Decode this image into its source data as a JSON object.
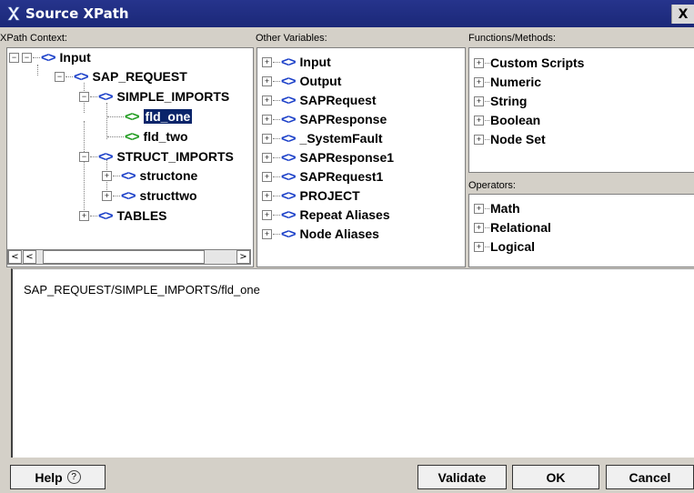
{
  "window": {
    "title": "Source XPath",
    "close_label": "X"
  },
  "context": {
    "label": "XPath Context:",
    "items": [
      {
        "label": "Input"
      },
      {
        "label": "SAP_REQUEST"
      },
      {
        "label": "SIMPLE_IMPORTS"
      },
      {
        "label": "fld_one"
      },
      {
        "label": "fld_two"
      },
      {
        "label": "STRUCT_IMPORTS"
      },
      {
        "label": "structone"
      },
      {
        "label": "structtwo"
      },
      {
        "label": "TABLES"
      }
    ]
  },
  "variables": {
    "label": "Other Variables:",
    "items": [
      {
        "label": "Input"
      },
      {
        "label": "Output"
      },
      {
        "label": "SAPRequest"
      },
      {
        "label": "SAPResponse"
      },
      {
        "label": "_SystemFault"
      },
      {
        "label": "SAPResponse1"
      },
      {
        "label": "SAPRequest1"
      },
      {
        "label": "PROJECT"
      },
      {
        "label": "Repeat Aliases"
      },
      {
        "label": "Node Aliases"
      }
    ]
  },
  "functions": {
    "label": "Functions/Methods:",
    "items": [
      {
        "label": "Custom Scripts"
      },
      {
        "label": "Numeric"
      },
      {
        "label": "String"
      },
      {
        "label": "Boolean"
      },
      {
        "label": "Node Set"
      }
    ]
  },
  "operators": {
    "label": "Operators:",
    "items": [
      {
        "label": "Math"
      },
      {
        "label": "Relational"
      },
      {
        "label": "Logical"
      }
    ]
  },
  "expression": {
    "value": "SAP_REQUEST/SIMPLE_IMPORTS/fld_one"
  },
  "buttons": {
    "help": "Help",
    "validate": "Validate",
    "ok": "OK",
    "cancel": "Cancel"
  },
  "colors": {
    "title_bar": "#26348c",
    "tag_blue": "#1a3fc8",
    "tag_green": "#1f9b1f",
    "selection": "#0a246a"
  }
}
